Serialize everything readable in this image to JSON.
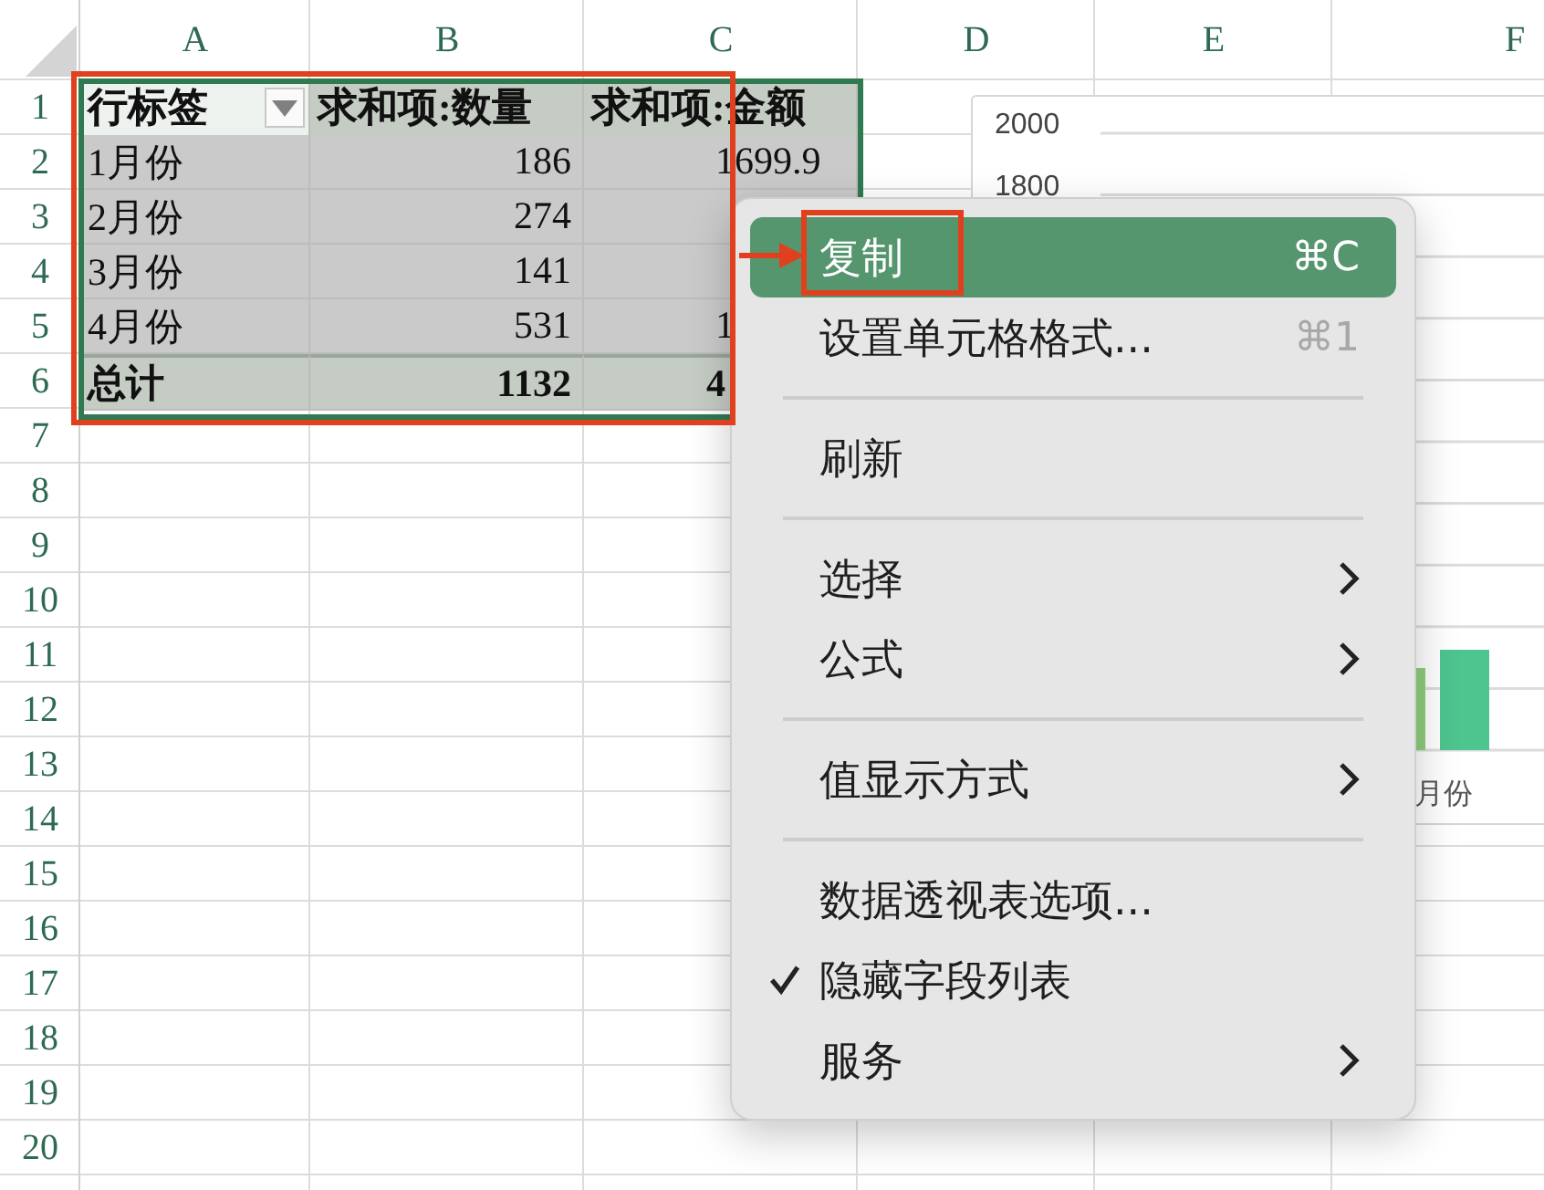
{
  "sheet": {
    "columns": [
      "A",
      "B",
      "C",
      "D",
      "E",
      "F"
    ],
    "rows": [
      "1",
      "2",
      "3",
      "4",
      "5",
      "6",
      "7",
      "8",
      "9",
      "10",
      "11",
      "12",
      "13",
      "14",
      "15",
      "16",
      "17",
      "18",
      "19",
      "20"
    ]
  },
  "pivot": {
    "header": [
      {
        "text": "行标签",
        "filter": true
      },
      {
        "text": "求和项:数量",
        "filter": false
      },
      {
        "text": "求和项:金额",
        "filter": false
      }
    ],
    "rows": [
      {
        "label": "1月份",
        "qty": "186",
        "amount": "1699.9"
      },
      {
        "label": "2月份",
        "qty": "274"
      },
      {
        "label": "3月份",
        "qty": "141"
      },
      {
        "label": "4月份",
        "qty": "531",
        "amount": "1"
      }
    ],
    "total": {
      "label": "总计",
      "qty": "1132",
      "amount": "4"
    }
  },
  "chart": {
    "y_labels": [
      "2000",
      "1800"
    ],
    "x_label": "月份"
  },
  "context_menu": {
    "items": [
      {
        "kind": "item",
        "label": "复制",
        "shortcut": "⌘C",
        "submenu": false,
        "checked": false,
        "selected": true
      },
      {
        "kind": "item",
        "label": "设置单元格格式...",
        "shortcut": "⌘1",
        "submenu": false,
        "checked": false,
        "selected": false
      },
      {
        "kind": "separator"
      },
      {
        "kind": "item",
        "label": "刷新",
        "submenu": false,
        "checked": false,
        "selected": false
      },
      {
        "kind": "separator"
      },
      {
        "kind": "item",
        "label": "选择",
        "submenu": true,
        "checked": false,
        "selected": false
      },
      {
        "kind": "item",
        "label": "公式",
        "submenu": true,
        "checked": false,
        "selected": false
      },
      {
        "kind": "separator"
      },
      {
        "kind": "item",
        "label": "值显示方式",
        "submenu": true,
        "checked": false,
        "selected": false
      },
      {
        "kind": "separator"
      },
      {
        "kind": "item",
        "label": "数据透视表选项...",
        "submenu": false,
        "checked": false,
        "selected": false
      },
      {
        "kind": "item",
        "label": "隐藏字段列表",
        "submenu": false,
        "checked": true,
        "selected": false
      },
      {
        "kind": "item",
        "label": "服务",
        "submenu": true,
        "checked": false,
        "selected": false
      }
    ]
  }
}
